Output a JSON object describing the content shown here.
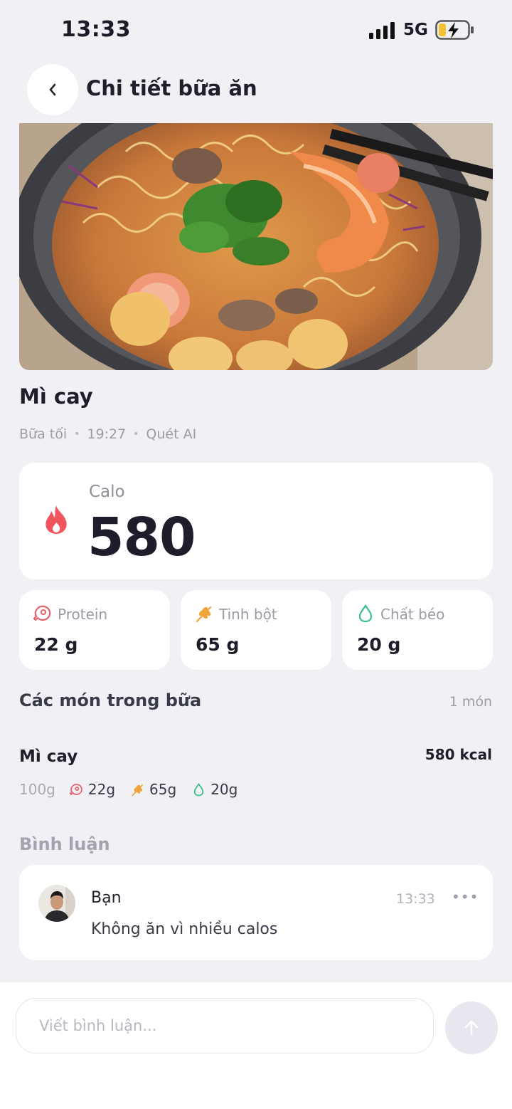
{
  "status_bar": {
    "time": "13:33",
    "network": "5G"
  },
  "header": {
    "title": "Chi tiết bữa ăn"
  },
  "meal": {
    "name": "Mì cay",
    "meal_type": "Bữa tối",
    "time": "19:27",
    "source": "Quét AI"
  },
  "calories": {
    "label": "Calo",
    "value": "580"
  },
  "macros": [
    {
      "label": "Protein",
      "value": "22 g",
      "icon": "meat-icon",
      "color": "#e8606a"
    },
    {
      "label": "Tinh bột",
      "value": "65 g",
      "icon": "wheat-icon",
      "color": "#f0a43a"
    },
    {
      "label": "Chất béo",
      "value": "20 g",
      "icon": "drop-icon",
      "color": "#3bbf8a"
    }
  ],
  "items_section": {
    "title": "Các món trong bữa",
    "count": "1 món"
  },
  "items": [
    {
      "name": "Mì cay",
      "kcal": "580 kcal",
      "weight": "100g",
      "protein": "22g",
      "carbs": "65g",
      "fat": "20g"
    }
  ],
  "comments_section": {
    "title": "Bình luận"
  },
  "comments": [
    {
      "author": "Bạn",
      "time": "13:33",
      "text": "Không ăn vì nhiều calos"
    }
  ],
  "comment_input": {
    "placeholder": "Viết bình luận..."
  },
  "colors": {
    "background": "#f1f1f5",
    "calorie_accent": "#f0555d",
    "send_button": "#e6e7ef"
  }
}
